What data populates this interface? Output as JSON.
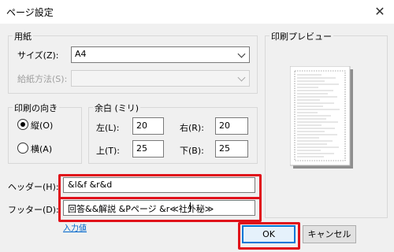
{
  "window": {
    "title": "ページ設定",
    "close_glyph": "✕"
  },
  "paper": {
    "group_title": "用紙",
    "size_label": "サイズ(Z):",
    "size_value": "A4",
    "source_label": "給紙方法(S):",
    "source_value": ""
  },
  "orientation": {
    "group_title": "印刷の向き",
    "portrait_label": "縦(O)",
    "landscape_label": "横(A)",
    "selected": "portrait"
  },
  "margins": {
    "group_title": "余白 (ミリ)",
    "left_label": "左(L):",
    "left_value": "20",
    "right_label": "右(R):",
    "right_value": "20",
    "top_label": "上(T):",
    "top_value": "25",
    "bottom_label": "下(B):",
    "bottom_value": "25"
  },
  "preview": {
    "group_title": "印刷プレビュー"
  },
  "header": {
    "label": "ヘッダー(H):",
    "value": "&l&f &r&d"
  },
  "footer": {
    "label": "フッター(D):",
    "value": "回答&&解説 &Pページ &r≪社外秘≫"
  },
  "input_values_link": "入力値",
  "buttons": {
    "ok": "OK",
    "cancel": "キャンセル"
  },
  "colors": {
    "highlight": "#e0101a",
    "accent": "#0078d7",
    "link": "#0066cc"
  }
}
